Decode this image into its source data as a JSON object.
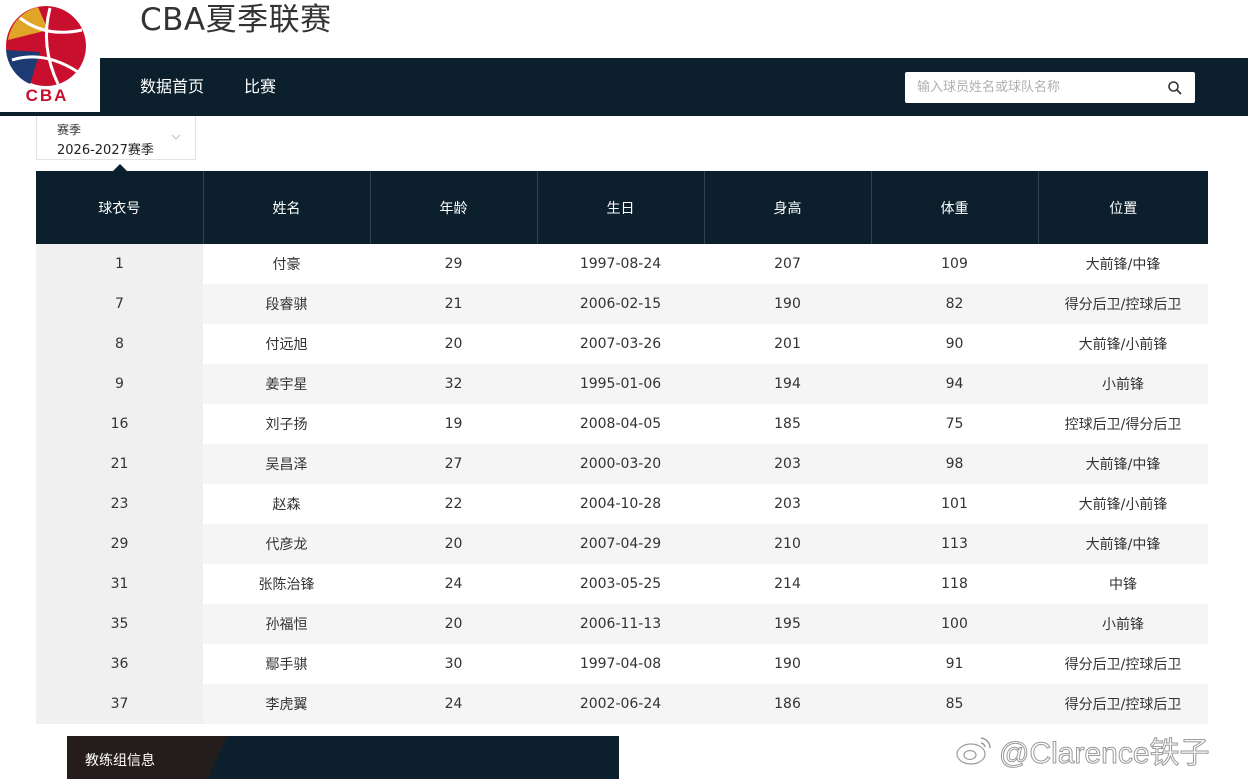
{
  "site": {
    "title": "CBA夏季联赛",
    "logo_text": "CBA"
  },
  "nav": {
    "items": [
      {
        "label": "数据首页"
      },
      {
        "label": "比赛"
      }
    ],
    "search_placeholder": "输入球员姓名或球队名称"
  },
  "season": {
    "label": "赛季",
    "value": "2026-2027赛季"
  },
  "table": {
    "headers": [
      "球衣号",
      "姓名",
      "年龄",
      "生日",
      "身高",
      "体重",
      "位置"
    ],
    "rows": [
      [
        "1",
        "付豪",
        "29",
        "1997-08-24",
        "207",
        "109",
        "大前锋/中锋"
      ],
      [
        "7",
        "段睿骐",
        "21",
        "2006-02-15",
        "190",
        "82",
        "得分后卫/控球后卫"
      ],
      [
        "8",
        "付远旭",
        "20",
        "2007-03-26",
        "201",
        "90",
        "大前锋/小前锋"
      ],
      [
        "9",
        "姜宇星",
        "32",
        "1995-01-06",
        "194",
        "94",
        "小前锋"
      ],
      [
        "16",
        "刘子扬",
        "19",
        "2008-04-05",
        "185",
        "75",
        "控球后卫/得分后卫"
      ],
      [
        "21",
        "吴昌泽",
        "27",
        "2000-03-20",
        "203",
        "98",
        "大前锋/中锋"
      ],
      [
        "23",
        "赵森",
        "22",
        "2004-10-28",
        "203",
        "101",
        "大前锋/小前锋"
      ],
      [
        "29",
        "代彦龙",
        "20",
        "2007-04-29",
        "210",
        "113",
        "大前锋/中锋"
      ],
      [
        "31",
        "张陈治锋",
        "24",
        "2003-05-25",
        "214",
        "118",
        "中锋"
      ],
      [
        "35",
        "孙福恒",
        "20",
        "2006-11-13",
        "195",
        "100",
        "小前锋"
      ],
      [
        "36",
        "鄢手骐",
        "30",
        "1997-04-08",
        "190",
        "91",
        "得分后卫/控球后卫"
      ],
      [
        "37",
        "李虎翼",
        "24",
        "2002-06-24",
        "186",
        "85",
        "得分后卫/控球后卫"
      ]
    ]
  },
  "coach_section": {
    "title": "教练组信息"
  },
  "watermark": {
    "text": "@Clarence铁子"
  },
  "colors": {
    "nav_bg": "#0b1f2d",
    "logo_red": "#c8102e",
    "logo_gold": "#e0a526",
    "logo_blue": "#1d3b73"
  }
}
